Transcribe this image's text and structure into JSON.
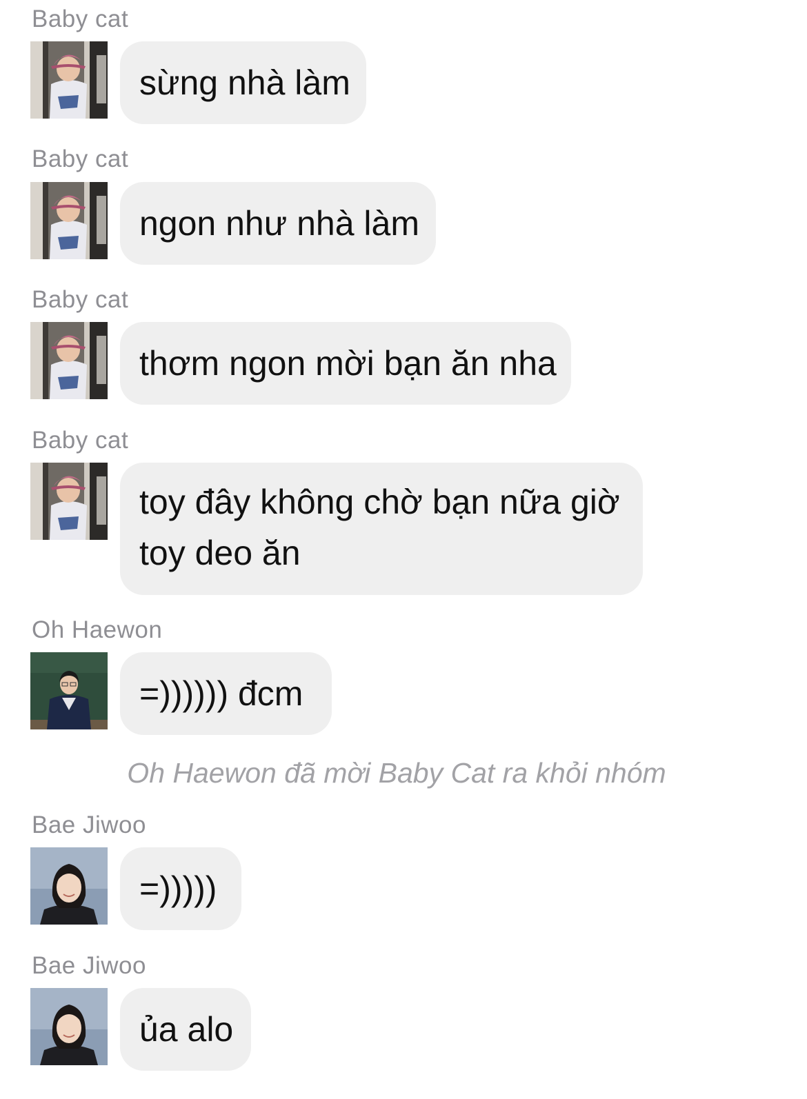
{
  "messages": [
    {
      "sender": "Baby cat",
      "text": "sừng nhà làm",
      "avatar": "avatar-baby-cat"
    },
    {
      "sender": "Baby cat",
      "text": "ngon như nhà làm",
      "avatar": "avatar-baby-cat"
    },
    {
      "sender": "Baby cat",
      "text": "thơm ngon mời bạn ăn nha",
      "avatar": "avatar-baby-cat"
    },
    {
      "sender": "Baby cat",
      "text_lines": [
        "toy đây không chờ bạn nữa giờ",
        "toy deo ăn"
      ],
      "avatar": "avatar-baby-cat"
    },
    {
      "sender": "Oh Haewon",
      "text": "=)))))) đcm",
      "avatar": "avatar-oh-haewon"
    },
    {
      "sender": "Bae Jiwoo",
      "text": "=)))))",
      "avatar": "avatar-bae-jiwoo"
    },
    {
      "sender": "Bae Jiwoo",
      "text": "ủa alo",
      "avatar": "avatar-bae-jiwoo"
    }
  ],
  "system_message": "Oh Haewon đã mời Baby Cat ra khỏi nhóm",
  "colors": {
    "bubble_bg": "#efefef",
    "sender_text": "#8e8e93",
    "system_text": "#a2a2a6",
    "message_text": "#111111"
  }
}
